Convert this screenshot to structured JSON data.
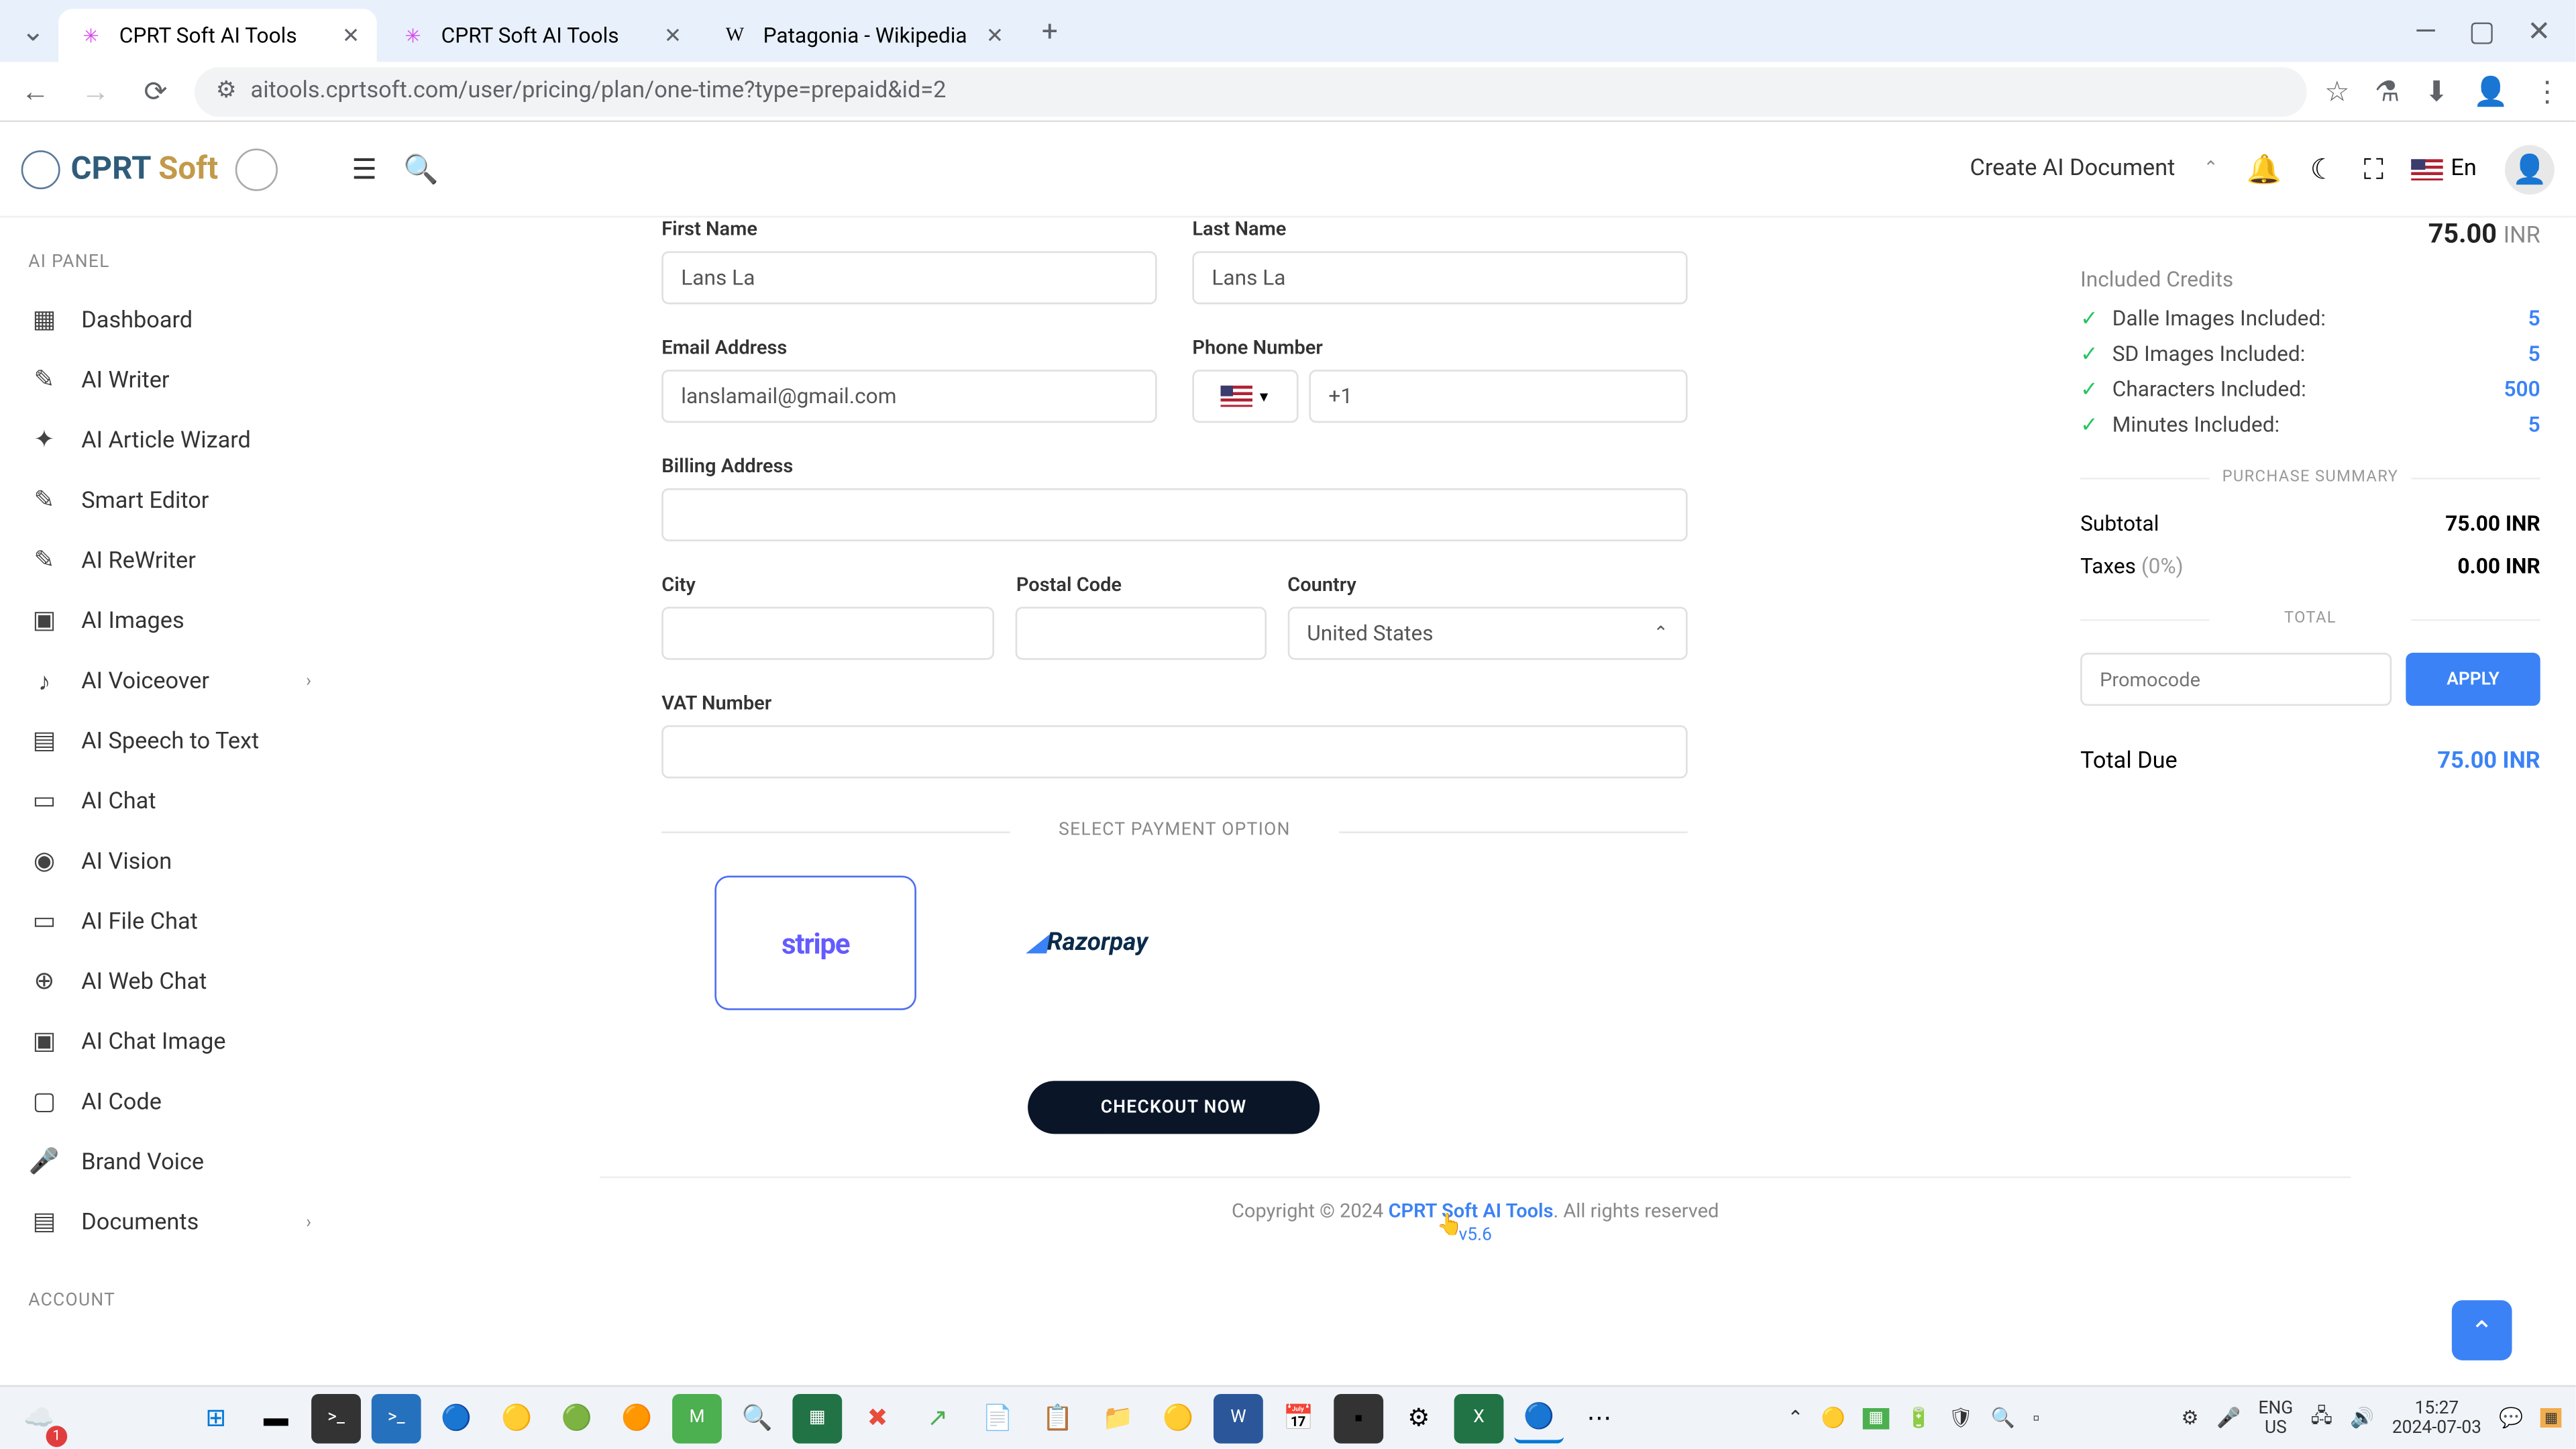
{
  "browser": {
    "tabs": [
      {
        "title": "CPRT Soft AI Tools",
        "fav": "✳"
      },
      {
        "title": "CPRT Soft AI Tools",
        "fav": "✳"
      },
      {
        "title": "Patagonia - Wikipedia",
        "fav": "W"
      }
    ],
    "url": "aitools.cprtsoft.com/user/pricing/plan/one-time?type=prepaid&id=2"
  },
  "header": {
    "logo1": "CPRT",
    "logo2": " Soft",
    "create_doc": "Create AI Document",
    "lang": "En"
  },
  "sidebar": {
    "section1": "AI PANEL",
    "items": [
      {
        "label": "Dashboard",
        "icon": "▦"
      },
      {
        "label": "AI Writer",
        "icon": "✎"
      },
      {
        "label": "AI Article Wizard",
        "icon": "✦"
      },
      {
        "label": "Smart Editor",
        "icon": "✎"
      },
      {
        "label": "AI ReWriter",
        "icon": "✎"
      },
      {
        "label": "AI Images",
        "icon": "▣"
      },
      {
        "label": "AI Voiceover",
        "icon": "♪",
        "expand": true
      },
      {
        "label": "AI Speech to Text",
        "icon": "▤"
      },
      {
        "label": "AI Chat",
        "icon": "▭"
      },
      {
        "label": "AI Vision",
        "icon": "◉"
      },
      {
        "label": "AI File Chat",
        "icon": "▭"
      },
      {
        "label": "AI Web Chat",
        "icon": "⊕"
      },
      {
        "label": "AI Chat Image",
        "icon": "▣"
      },
      {
        "label": "AI Code",
        "icon": "▢"
      },
      {
        "label": "Brand Voice",
        "icon": "🎤"
      },
      {
        "label": "Documents",
        "icon": "▤",
        "expand": true
      }
    ],
    "section2": "ACCOUNT"
  },
  "form": {
    "first_name_label": "First Name",
    "first_name": "Lans La",
    "last_name_label": "Last Name",
    "last_name": "Lans La",
    "email_label": "Email Address",
    "email": "lanslamail@gmail.com",
    "phone_label": "Phone Number",
    "phone_cc": "+1",
    "phone": "",
    "billing_label": "Billing Address",
    "city_label": "City",
    "postal_label": "Postal Code",
    "country_label": "Country",
    "country": "United States",
    "vat_label": "VAT Number",
    "pay_divider": "SELECT PAYMENT OPTION",
    "stripe": "stripe",
    "razorpay": "Razorpay",
    "checkout": "CHECKOUT NOW"
  },
  "summary": {
    "price": "75.00",
    "currency": "INR",
    "included_header": "Included Credits",
    "credits": [
      {
        "label": "Dalle Images Included:",
        "val": "5"
      },
      {
        "label": "SD Images Included:",
        "val": "5"
      },
      {
        "label": "Characters Included:",
        "val": "500"
      },
      {
        "label": "Minutes Included:",
        "val": "5"
      }
    ],
    "sum_header": "PURCHASE SUMMARY",
    "subtotal_label": "Subtotal",
    "subtotal": "75.00 INR",
    "taxes_label": "Taxes",
    "taxes_pct": "(0%)",
    "taxes": "0.00 INR",
    "total_header": "TOTAL",
    "promo_placeholder": "Promocode",
    "apply": "APPLY",
    "total_due_label": "Total Due",
    "total_due": "75.00 INR"
  },
  "footer": {
    "copy_pre": "Copyright © 2024 ",
    "brand": "CPRT Soft AI Tools",
    "copy_post": ". All rights reserved",
    "version": "v5.6"
  },
  "taskbar": {
    "lang1": "ENG",
    "lang2": "US",
    "time": "15:27",
    "date": "2024-07-03"
  }
}
